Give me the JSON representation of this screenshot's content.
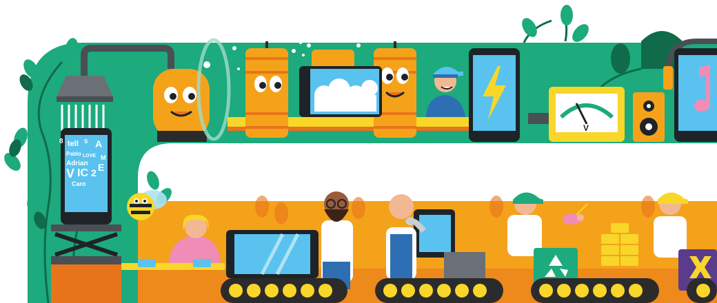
{
  "scene": {
    "description_kind": "illustration",
    "phone_screen_words": [
      "tell",
      "A",
      "Pablo",
      "LOVE",
      "Adrian",
      "V",
      "IC",
      "Caro",
      "2",
      "E",
      "8",
      "M",
      "S"
    ],
    "colors": {
      "green_band": "#1daa7d",
      "dark_green": "#0f6b4a",
      "orange_band": "#f5a21b",
      "deep_orange": "#e8741b",
      "screen_blue": "#5ac2ee",
      "phone_dark": "#1e2328",
      "yellow": "#f8d62a",
      "pink": "#f08cb6",
      "conveyor_dark": "#2b2b2b",
      "purple": "#5a3b8c"
    },
    "icons": [
      "shower-icon",
      "lightning-icon",
      "music-note-icon",
      "recycle-icon",
      "wrench-icon",
      "cross-icon",
      "bee-icon",
      "bird-icon"
    ]
  }
}
